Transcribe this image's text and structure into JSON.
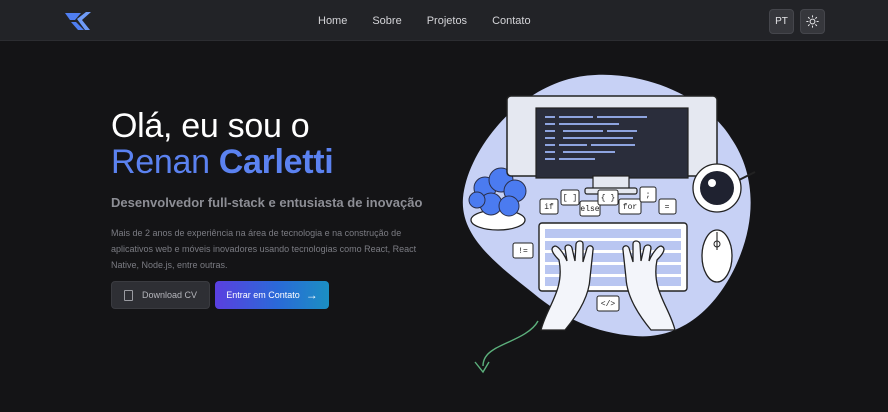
{
  "nav": {
    "links": [
      "Home",
      "Sobre",
      "Projetos",
      "Contato"
    ],
    "lang": "PT"
  },
  "hero": {
    "greeting": "Olá, eu sou o",
    "first_name": "Renan",
    "last_name": "Carletti",
    "subtitle": "Desenvolvedor full-stack e entusiasta de inovação",
    "description": "Mais de 2 anos de experiência na área de tecnologia e na construção de aplicativos web e móveis inovadores usando tecnologias como React, React Native, Node.js, entre outras.",
    "cv_button": "Download CV",
    "contact_button": "Entrar em Contato"
  },
  "illustration": {
    "bubbles": [
      "if",
      "[ ]",
      "else",
      "{ }",
      "for",
      ";",
      "=",
      "!=",
      "</>"
    ]
  },
  "colors": {
    "accent": "#5b82f0",
    "background": "#141416",
    "navbar": "#222327",
    "blob": "#c7d1f5",
    "gradient_start": "#5a3fe0",
    "gradient_end": "#1b8fc2"
  }
}
